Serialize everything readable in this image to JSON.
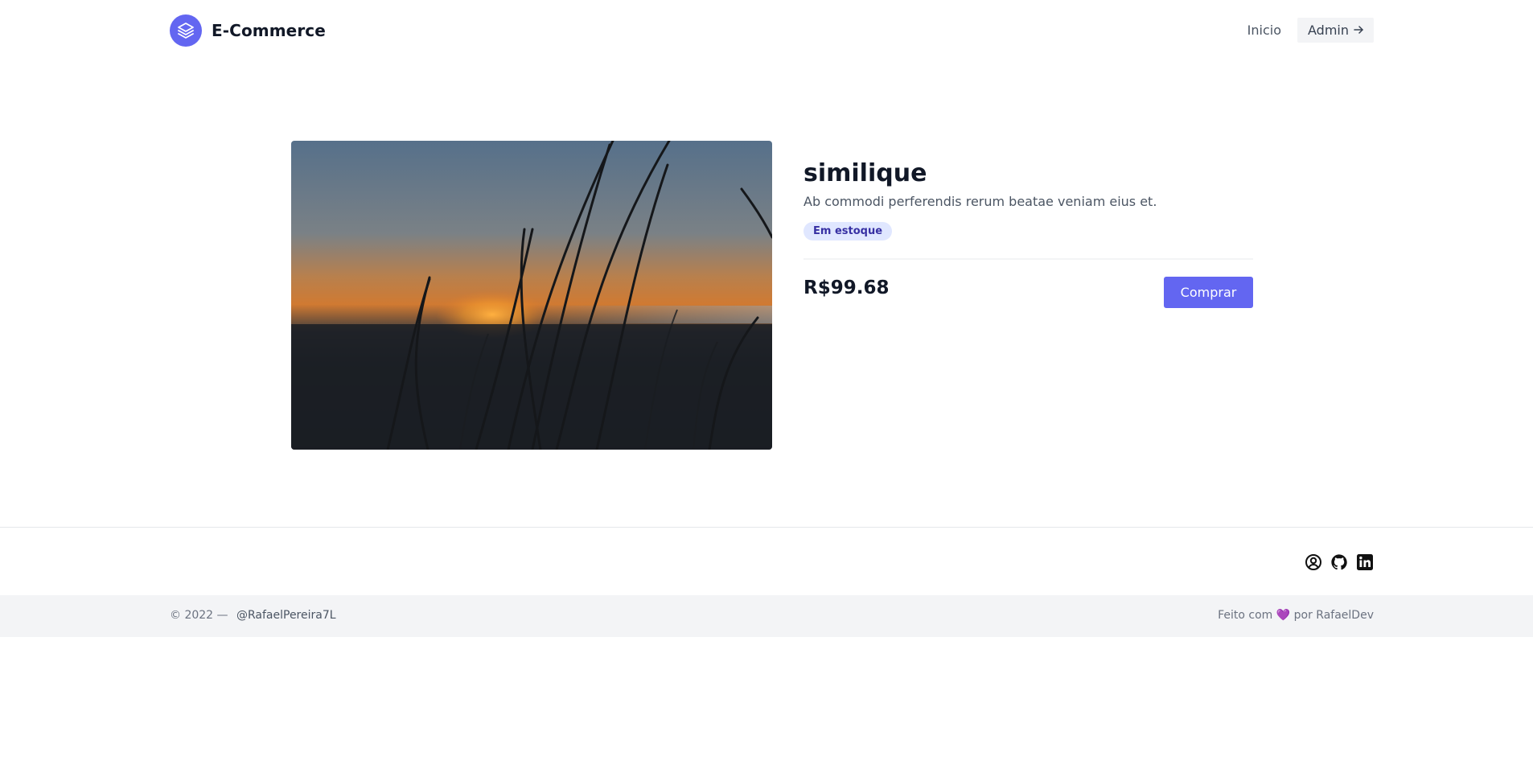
{
  "header": {
    "brand": "E-Commerce",
    "nav": {
      "home": "Inicio",
      "admin": "Admin"
    }
  },
  "product": {
    "title": "similique",
    "description": "Ab commodi perferendis rerum beatae veniam eius et.",
    "stock_badge": "Em estoque",
    "price": "R$99.68",
    "buy_label": "Comprar",
    "image_alt": "sunset-grass-photo"
  },
  "footer": {
    "social_icons": [
      "user-circle-icon",
      "github-icon",
      "linkedin-icon"
    ],
    "copyright": "© 2022 —",
    "handle": "@RafaelPereira7L",
    "made_prefix": "Feito com",
    "made_heart": "💜",
    "made_suffix": "por RafaelDev"
  },
  "colors": {
    "accent": "#6366f1",
    "badge_bg": "#e0e7ff",
    "badge_text": "#3730a3",
    "footer_bg": "#f3f4f6"
  }
}
